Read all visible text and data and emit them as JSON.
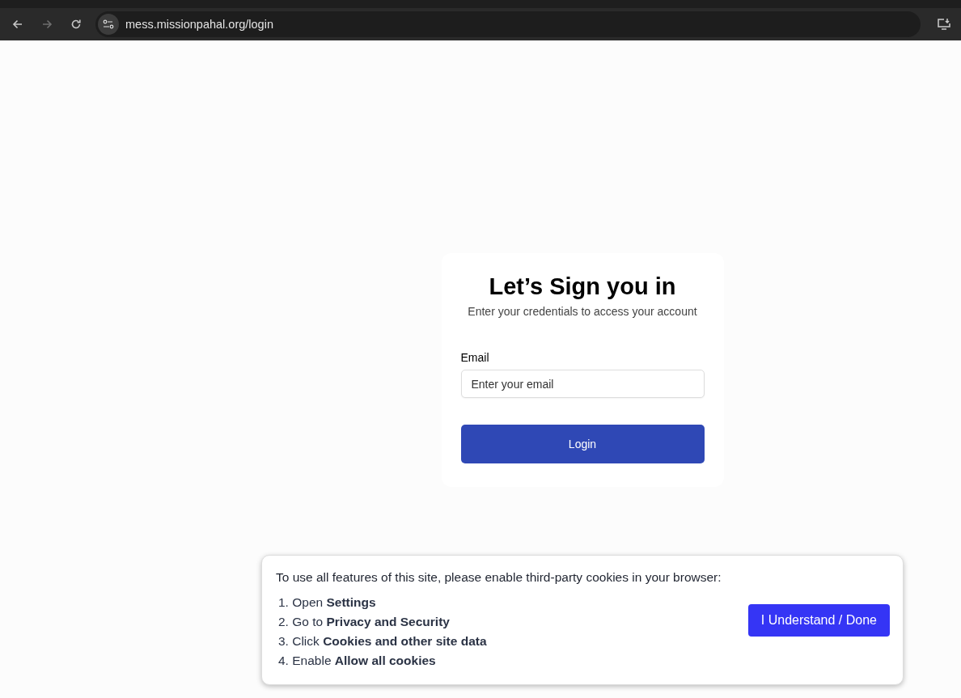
{
  "browser": {
    "url": "mess.missionpahal.org/login",
    "back_disabled": false,
    "forward_disabled": true
  },
  "login": {
    "title": "Let’s Sign you in",
    "subtitle": "Enter your credentials to access your account",
    "email_label": "Email",
    "email_placeholder": "Enter your email",
    "button": "Login"
  },
  "cookie_notice": {
    "message": "To use all features of this site, please enable third-party cookies in your browser:",
    "steps": [
      "1. Open **Settings**",
      "2. Go to **Privacy and Security**",
      "3. Click **Cookies and other site data**",
      "4. Enable **Allow all cookies**"
    ],
    "button": "I Understand / Done"
  }
}
